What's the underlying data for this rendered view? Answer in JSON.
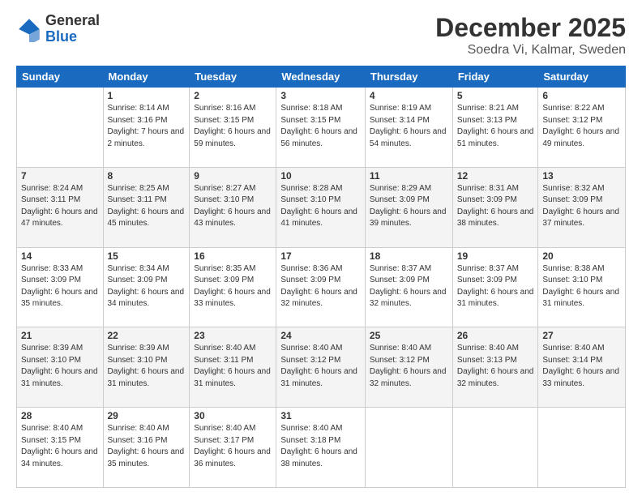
{
  "header": {
    "logo_general": "General",
    "logo_blue": "Blue",
    "month_title": "December 2025",
    "location": "Soedra Vi, Kalmar, Sweden"
  },
  "days_of_week": [
    "Sunday",
    "Monday",
    "Tuesday",
    "Wednesday",
    "Thursday",
    "Friday",
    "Saturday"
  ],
  "weeks": [
    [
      {
        "day": "",
        "sunrise": "",
        "sunset": "",
        "daylight": ""
      },
      {
        "day": "1",
        "sunrise": "Sunrise: 8:14 AM",
        "sunset": "Sunset: 3:16 PM",
        "daylight": "Daylight: 7 hours and 2 minutes."
      },
      {
        "day": "2",
        "sunrise": "Sunrise: 8:16 AM",
        "sunset": "Sunset: 3:15 PM",
        "daylight": "Daylight: 6 hours and 59 minutes."
      },
      {
        "day": "3",
        "sunrise": "Sunrise: 8:18 AM",
        "sunset": "Sunset: 3:15 PM",
        "daylight": "Daylight: 6 hours and 56 minutes."
      },
      {
        "day": "4",
        "sunrise": "Sunrise: 8:19 AM",
        "sunset": "Sunset: 3:14 PM",
        "daylight": "Daylight: 6 hours and 54 minutes."
      },
      {
        "day": "5",
        "sunrise": "Sunrise: 8:21 AM",
        "sunset": "Sunset: 3:13 PM",
        "daylight": "Daylight: 6 hours and 51 minutes."
      },
      {
        "day": "6",
        "sunrise": "Sunrise: 8:22 AM",
        "sunset": "Sunset: 3:12 PM",
        "daylight": "Daylight: 6 hours and 49 minutes."
      }
    ],
    [
      {
        "day": "7",
        "sunrise": "Sunrise: 8:24 AM",
        "sunset": "Sunset: 3:11 PM",
        "daylight": "Daylight: 6 hours and 47 minutes."
      },
      {
        "day": "8",
        "sunrise": "Sunrise: 8:25 AM",
        "sunset": "Sunset: 3:11 PM",
        "daylight": "Daylight: 6 hours and 45 minutes."
      },
      {
        "day": "9",
        "sunrise": "Sunrise: 8:27 AM",
        "sunset": "Sunset: 3:10 PM",
        "daylight": "Daylight: 6 hours and 43 minutes."
      },
      {
        "day": "10",
        "sunrise": "Sunrise: 8:28 AM",
        "sunset": "Sunset: 3:10 PM",
        "daylight": "Daylight: 6 hours and 41 minutes."
      },
      {
        "day": "11",
        "sunrise": "Sunrise: 8:29 AM",
        "sunset": "Sunset: 3:09 PM",
        "daylight": "Daylight: 6 hours and 39 minutes."
      },
      {
        "day": "12",
        "sunrise": "Sunrise: 8:31 AM",
        "sunset": "Sunset: 3:09 PM",
        "daylight": "Daylight: 6 hours and 38 minutes."
      },
      {
        "day": "13",
        "sunrise": "Sunrise: 8:32 AM",
        "sunset": "Sunset: 3:09 PM",
        "daylight": "Daylight: 6 hours and 37 minutes."
      }
    ],
    [
      {
        "day": "14",
        "sunrise": "Sunrise: 8:33 AM",
        "sunset": "Sunset: 3:09 PM",
        "daylight": "Daylight: 6 hours and 35 minutes."
      },
      {
        "day": "15",
        "sunrise": "Sunrise: 8:34 AM",
        "sunset": "Sunset: 3:09 PM",
        "daylight": "Daylight: 6 hours and 34 minutes."
      },
      {
        "day": "16",
        "sunrise": "Sunrise: 8:35 AM",
        "sunset": "Sunset: 3:09 PM",
        "daylight": "Daylight: 6 hours and 33 minutes."
      },
      {
        "day": "17",
        "sunrise": "Sunrise: 8:36 AM",
        "sunset": "Sunset: 3:09 PM",
        "daylight": "Daylight: 6 hours and 32 minutes."
      },
      {
        "day": "18",
        "sunrise": "Sunrise: 8:37 AM",
        "sunset": "Sunset: 3:09 PM",
        "daylight": "Daylight: 6 hours and 32 minutes."
      },
      {
        "day": "19",
        "sunrise": "Sunrise: 8:37 AM",
        "sunset": "Sunset: 3:09 PM",
        "daylight": "Daylight: 6 hours and 31 minutes."
      },
      {
        "day": "20",
        "sunrise": "Sunrise: 8:38 AM",
        "sunset": "Sunset: 3:10 PM",
        "daylight": "Daylight: 6 hours and 31 minutes."
      }
    ],
    [
      {
        "day": "21",
        "sunrise": "Sunrise: 8:39 AM",
        "sunset": "Sunset: 3:10 PM",
        "daylight": "Daylight: 6 hours and 31 minutes."
      },
      {
        "day": "22",
        "sunrise": "Sunrise: 8:39 AM",
        "sunset": "Sunset: 3:10 PM",
        "daylight": "Daylight: 6 hours and 31 minutes."
      },
      {
        "day": "23",
        "sunrise": "Sunrise: 8:40 AM",
        "sunset": "Sunset: 3:11 PM",
        "daylight": "Daylight: 6 hours and 31 minutes."
      },
      {
        "day": "24",
        "sunrise": "Sunrise: 8:40 AM",
        "sunset": "Sunset: 3:12 PM",
        "daylight": "Daylight: 6 hours and 31 minutes."
      },
      {
        "day": "25",
        "sunrise": "Sunrise: 8:40 AM",
        "sunset": "Sunset: 3:12 PM",
        "daylight": "Daylight: 6 hours and 32 minutes."
      },
      {
        "day": "26",
        "sunrise": "Sunrise: 8:40 AM",
        "sunset": "Sunset: 3:13 PM",
        "daylight": "Daylight: 6 hours and 32 minutes."
      },
      {
        "day": "27",
        "sunrise": "Sunrise: 8:40 AM",
        "sunset": "Sunset: 3:14 PM",
        "daylight": "Daylight: 6 hours and 33 minutes."
      }
    ],
    [
      {
        "day": "28",
        "sunrise": "Sunrise: 8:40 AM",
        "sunset": "Sunset: 3:15 PM",
        "daylight": "Daylight: 6 hours and 34 minutes."
      },
      {
        "day": "29",
        "sunrise": "Sunrise: 8:40 AM",
        "sunset": "Sunset: 3:16 PM",
        "daylight": "Daylight: 6 hours and 35 minutes."
      },
      {
        "day": "30",
        "sunrise": "Sunrise: 8:40 AM",
        "sunset": "Sunset: 3:17 PM",
        "daylight": "Daylight: 6 hours and 36 minutes."
      },
      {
        "day": "31",
        "sunrise": "Sunrise: 8:40 AM",
        "sunset": "Sunset: 3:18 PM",
        "daylight": "Daylight: 6 hours and 38 minutes."
      },
      {
        "day": "",
        "sunrise": "",
        "sunset": "",
        "daylight": ""
      },
      {
        "day": "",
        "sunrise": "",
        "sunset": "",
        "daylight": ""
      },
      {
        "day": "",
        "sunrise": "",
        "sunset": "",
        "daylight": ""
      }
    ]
  ]
}
